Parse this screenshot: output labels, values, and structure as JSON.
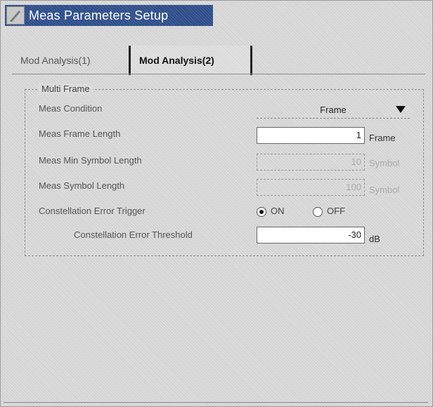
{
  "window": {
    "title": "Meas Parameters Setup"
  },
  "tabs": [
    {
      "label": "Mod Analysis(1)"
    },
    {
      "label": "Mod Analysis(2)"
    }
  ],
  "group": {
    "title": "Multi Frame"
  },
  "fields": {
    "meas_condition": {
      "label": "Meas Condition",
      "value": "Frame"
    },
    "meas_frame_length": {
      "label": "Meas Frame Length",
      "value": "1",
      "unit": "Frame"
    },
    "meas_min_symbol_length": {
      "label": "Meas Min Symbol Length",
      "value": "10",
      "unit": "Symbol"
    },
    "meas_symbol_length": {
      "label": "Meas Symbol Length",
      "value": "100",
      "unit": "Symbol"
    },
    "constellation_error_trigger": {
      "label": "Constellation Error Trigger",
      "on_label": "ON",
      "off_label": "OFF",
      "selected": "ON"
    },
    "constellation_error_threshold": {
      "label": "Constellation Error Threshold",
      "value": "-30",
      "unit": "dB"
    }
  }
}
